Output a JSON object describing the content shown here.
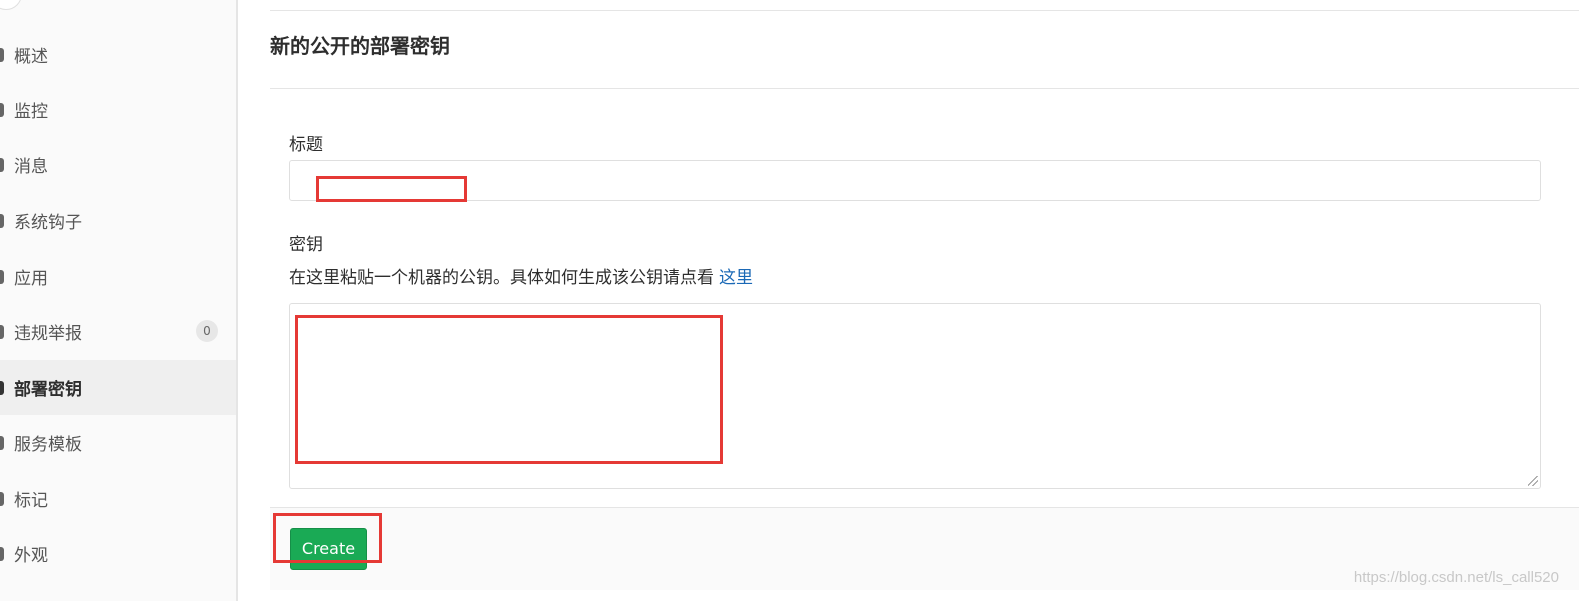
{
  "sidebar": {
    "items": [
      {
        "label": "概述",
        "active": false
      },
      {
        "label": "监控",
        "active": false
      },
      {
        "label": "消息",
        "active": false
      },
      {
        "label": "系统钩子",
        "active": false
      },
      {
        "label": "应用",
        "active": false
      },
      {
        "label": "违规举报",
        "active": false,
        "badge": "0"
      },
      {
        "label": "部署密钥",
        "active": true
      },
      {
        "label": "服务模板",
        "active": false
      },
      {
        "label": "标记",
        "active": false
      },
      {
        "label": "外观",
        "active": false
      }
    ]
  },
  "main": {
    "title": "新的公开的部署密钥",
    "title_field": {
      "label": "标题",
      "value": ""
    },
    "key_field": {
      "label": "密钥",
      "help_text": "在这里粘贴一个机器的公钥。具体如何生成该公钥请点看",
      "help_link": "这里",
      "value": ""
    },
    "create_label": "Create"
  },
  "watermark": "https://blog.csdn.net/ls_call520",
  "colors": {
    "accent": "#1aaa55",
    "link": "#1b69b6",
    "annotation": "#e53935"
  }
}
